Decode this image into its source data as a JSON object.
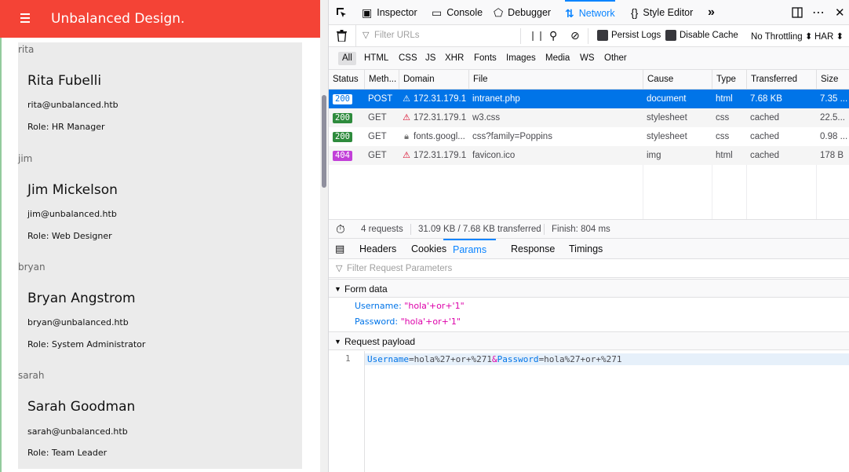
{
  "page": {
    "brand": "Unbalanced Design.",
    "users": [
      {
        "section": "rita",
        "name": "Rita Fubelli",
        "email": "rita@unbalanced.htb",
        "role": "Role: HR Manager"
      },
      {
        "section": "jim",
        "name": "Jim Mickelson",
        "email": "jim@unbalanced.htb",
        "role": "Role: Web Designer"
      },
      {
        "section": "bryan",
        "name": "Bryan Angstrom",
        "email": "bryan@unbalanced.htb",
        "role": "Role: System Administrator"
      },
      {
        "section": "sarah",
        "name": "Sarah Goodman",
        "email": "sarah@unbalanced.htb",
        "role": "Role: Team Leader"
      }
    ]
  },
  "colors": {
    "topbar": "#f44336",
    "accent": "#0a84ff",
    "selected_row": "#0074e8",
    "status_ok": "#2e8b3d",
    "status_404": "#c23fd8"
  },
  "devtools": {
    "tools": [
      "Inspector",
      "Console",
      "Debugger",
      "Network",
      "Style Editor"
    ],
    "active_tool": "Network",
    "filter_placeholder": "Filter URLs",
    "persist_logs": "Persist Logs",
    "disable_cache": "Disable Cache",
    "throttling": "No Throttling ⬍",
    "har": "HAR ⬍",
    "type_filters": [
      "All",
      "HTML",
      "CSS",
      "JS",
      "XHR",
      "Fonts",
      "Images",
      "Media",
      "WS",
      "Other"
    ],
    "columns": [
      "Status",
      "Meth...",
      "Domain",
      "File",
      "Cause",
      "Type",
      "Transferred",
      "Size"
    ],
    "requests": [
      {
        "status": "200",
        "method": "POST",
        "domain": "172.31.179.1",
        "file": "intranet.php",
        "cause": "document",
        "type": "html",
        "transferred": "7.68 KB",
        "size": "7.35 ..."
      },
      {
        "status": "200",
        "method": "GET",
        "domain": "172.31.179.1",
        "file": "w3.css",
        "cause": "stylesheet",
        "type": "css",
        "transferred": "cached",
        "size": "22.5..."
      },
      {
        "status": "200",
        "method": "GET",
        "domain": "fonts.googl...",
        "file": "css?family=Poppins",
        "cause": "stylesheet",
        "type": "css",
        "transferred": "cached",
        "size": "0.98 ..."
      },
      {
        "status": "404",
        "method": "GET",
        "domain": "172.31.179.1",
        "file": "favicon.ico",
        "cause": "img",
        "type": "html",
        "transferred": "cached",
        "size": "178 B"
      }
    ],
    "summary": {
      "requests": "4 requests",
      "transferred": "31.09 KB / 7.68 KB transferred",
      "finish": "Finish: 804 ms"
    },
    "detail_tabs": [
      "Headers",
      "Cookies",
      "Params",
      "Response",
      "Timings"
    ],
    "active_detail_tab": "Params",
    "params_filter_placeholder": "Filter Request Parameters",
    "form_data_title": "Form data",
    "form_data": [
      {
        "key": "Username:",
        "value": "\"hola'+or+'1\""
      },
      {
        "key": "Password:",
        "value": "\"hola'+or+'1\""
      }
    ],
    "payload_title": "Request payload",
    "payload_line_no": "1",
    "payload": {
      "k1": "Username",
      "v1": "=hola%27+or+%271",
      "amp": "&",
      "k2": "Password",
      "v2": "=hola%27+or+%271"
    }
  }
}
